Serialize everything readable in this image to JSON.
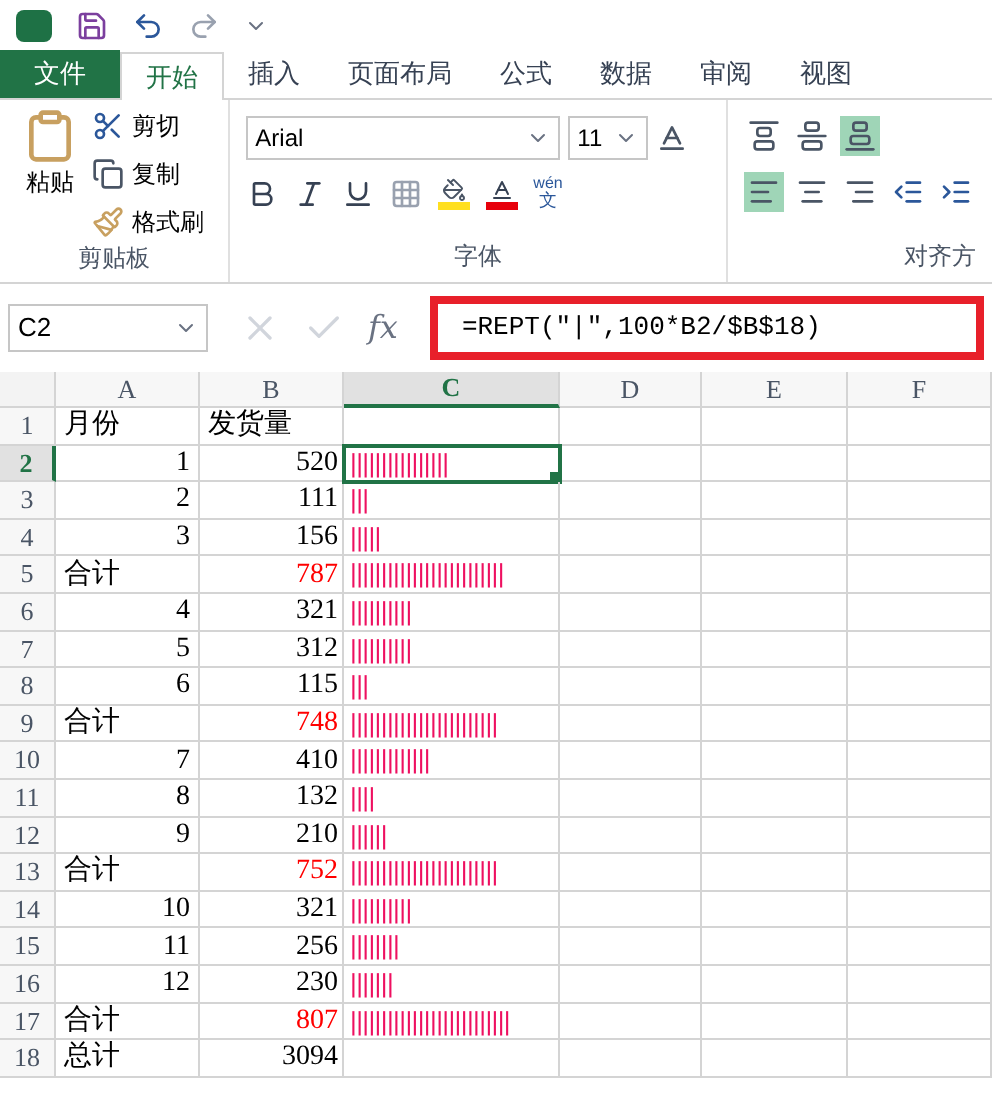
{
  "tabs": [
    {
      "label": "文件",
      "kind": "file",
      "selected": false
    },
    {
      "label": "开始",
      "kind": "tab",
      "selected": true
    },
    {
      "label": "插入",
      "kind": "tab",
      "selected": false
    },
    {
      "label": "页面布局",
      "kind": "tab",
      "selected": false
    },
    {
      "label": "公式",
      "kind": "tab",
      "selected": false
    },
    {
      "label": "数据",
      "kind": "tab",
      "selected": false
    },
    {
      "label": "审阅",
      "kind": "tab",
      "selected": false
    },
    {
      "label": "视图",
      "kind": "tab",
      "selected": false
    }
  ],
  "clipboard": {
    "paste": "粘贴",
    "cut": "剪切",
    "copy": "复制",
    "format_painter": "格式刷",
    "group": "剪贴板"
  },
  "font": {
    "name": "Arial",
    "size": "11",
    "phonetic_top": "wén",
    "phonetic_bottom": "文",
    "group": "字体"
  },
  "alignment": {
    "group": "对齐方",
    "bottom_align_selected": true,
    "left_align_selected": true
  },
  "name_box": "C2",
  "formula": "=REPT(″|″,100*B2/$B$18)",
  "formula_highlighted": true,
  "function_label": "fx",
  "columns": [
    {
      "label": "A",
      "selected": false
    },
    {
      "label": "B",
      "selected": false
    },
    {
      "label": "C",
      "selected": true
    },
    {
      "label": "D",
      "selected": false
    },
    {
      "label": "E",
      "selected": false
    },
    {
      "label": "F",
      "selected": false
    }
  ],
  "rows": [
    {
      "num": "1",
      "a": "月份",
      "b": "发货量",
      "c": "",
      "kind": "header",
      "selected": false
    },
    {
      "num": "2",
      "a": "1",
      "b": "520",
      "c": "||||||||||||||||",
      "kind": "month",
      "selected": true
    },
    {
      "num": "3",
      "a": "2",
      "b": "111",
      "c": "|||",
      "kind": "month",
      "selected": false
    },
    {
      "num": "4",
      "a": "3",
      "b": "156",
      "c": "|||||",
      "kind": "month",
      "selected": false
    },
    {
      "num": "5",
      "a": "合计",
      "b": "787",
      "c": "|||||||||||||||||||||||||",
      "kind": "subtotal",
      "selected": false
    },
    {
      "num": "6",
      "a": "4",
      "b": "321",
      "c": "||||||||||",
      "kind": "month",
      "selected": false
    },
    {
      "num": "7",
      "a": "5",
      "b": "312",
      "c": "||||||||||",
      "kind": "month",
      "selected": false
    },
    {
      "num": "8",
      "a": "6",
      "b": "115",
      "c": "|||",
      "kind": "month",
      "selected": false
    },
    {
      "num": "9",
      "a": "合计",
      "b": "748",
      "c": "||||||||||||||||||||||||",
      "kind": "subtotal",
      "selected": false
    },
    {
      "num": "10",
      "a": "7",
      "b": "410",
      "c": "|||||||||||||",
      "kind": "month",
      "selected": false
    },
    {
      "num": "11",
      "a": "8",
      "b": "132",
      "c": "||||",
      "kind": "month",
      "selected": false
    },
    {
      "num": "12",
      "a": "9",
      "b": "210",
      "c": "||||||",
      "kind": "month",
      "selected": false
    },
    {
      "num": "13",
      "a": "合计",
      "b": "752",
      "c": "||||||||||||||||||||||||",
      "kind": "subtotal",
      "selected": false
    },
    {
      "num": "14",
      "a": "10",
      "b": "321",
      "c": "||||||||||",
      "kind": "month",
      "selected": false
    },
    {
      "num": "15",
      "a": "11",
      "b": "256",
      "c": "||||||||",
      "kind": "month",
      "selected": false
    },
    {
      "num": "16",
      "a": "12",
      "b": "230",
      "c": "|||||||",
      "kind": "month",
      "selected": false
    },
    {
      "num": "17",
      "a": "合计",
      "b": "807",
      "c": "||||||||||||||||||||||||||",
      "kind": "subtotal",
      "selected": false
    },
    {
      "num": "18",
      "a": "总计",
      "b": "3094",
      "c": "",
      "kind": "total",
      "selected": false
    }
  ]
}
